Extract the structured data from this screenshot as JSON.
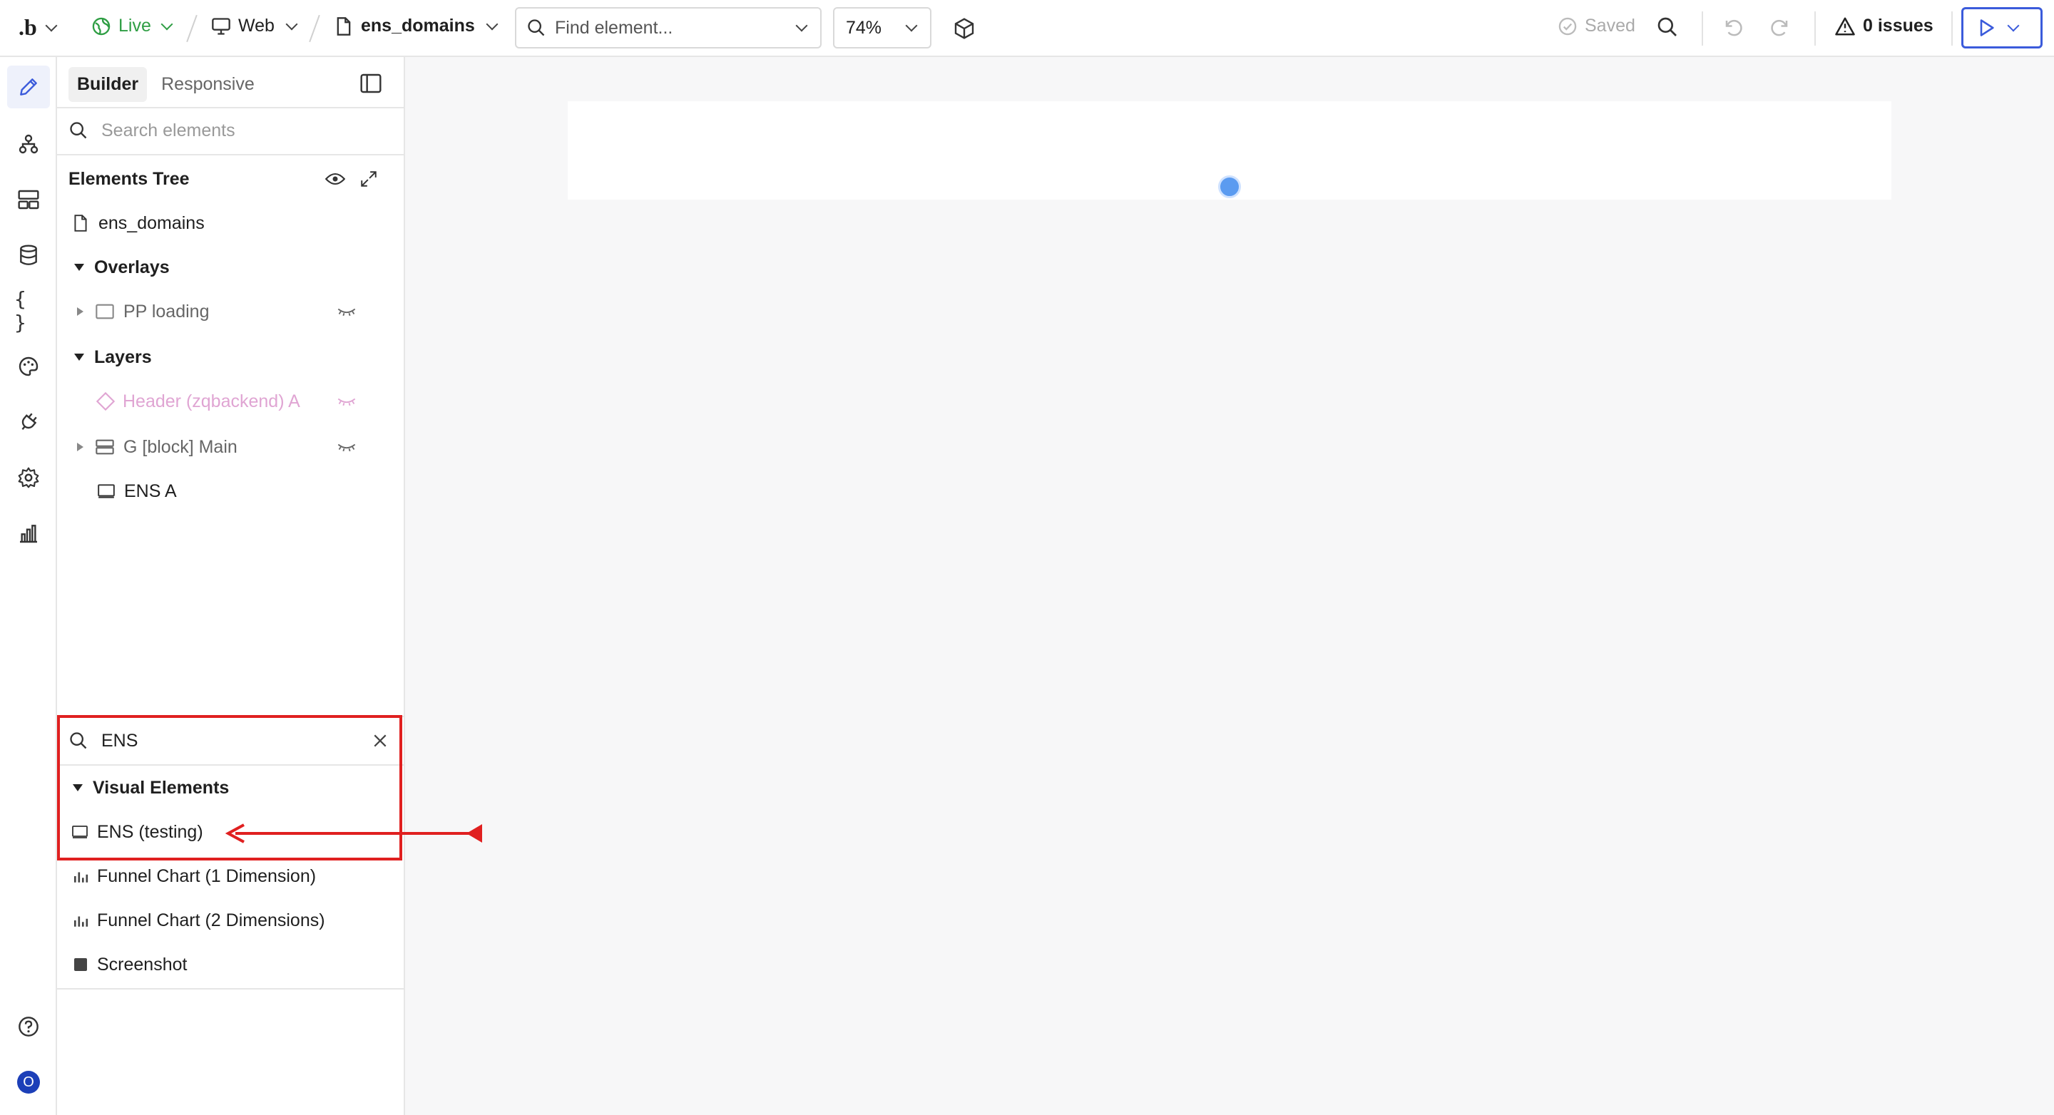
{
  "topbar": {
    "logo": ".b",
    "status": "Live",
    "platform": "Web",
    "page_name": "ens_domains",
    "find_placeholder": "Find element...",
    "zoom": "74%",
    "saved": "Saved",
    "issues": "0 issues"
  },
  "panel": {
    "tabs": [
      "Builder",
      "Responsive"
    ],
    "search_placeholder": "Search elements",
    "tree_title": "Elements Tree",
    "page_item": "ens_domains",
    "overlays_label": "Overlays",
    "overlay_items": [
      "PP loading"
    ],
    "layers_label": "Layers",
    "layer_items": [
      "Header (zqbackend) A",
      "G [block] Main",
      "ENS A"
    ]
  },
  "add_panel": {
    "search_value": "ENS",
    "section": "Visual Elements",
    "items": [
      "ENS (testing)",
      "Funnel Chart (1 Dimension)",
      "Funnel Chart (2 Dimensions)",
      "Screenshot"
    ]
  },
  "rail": {
    "bottom_avatar": "O"
  },
  "colors": {
    "accent": "#3b5bdb",
    "live_green": "#2f9e44",
    "annotation_red": "#e02020"
  }
}
